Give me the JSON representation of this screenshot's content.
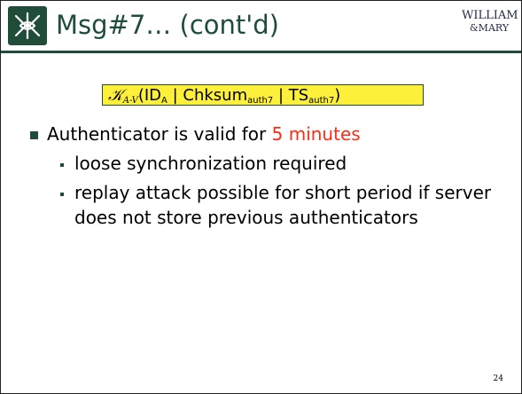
{
  "title": "Msg#7… (cont'd)",
  "brand": {
    "line1": "WILLIAM",
    "line2": "&MARY",
    "logo_icon": "cypher-seal-icon"
  },
  "formula": {
    "key_symbol": "𝒦",
    "key_sub": "A-V",
    "open": "(",
    "id": "ID",
    "id_sub": "A",
    "sep1": " | ",
    "chksum": "Chksum",
    "chksum_sub": "auth7",
    "sep2": " | ",
    "ts": "TS",
    "ts_sub": "auth7",
    "close": ")"
  },
  "bullet": {
    "prefix": "Authenticator is valid for ",
    "highlight": "5 minutes"
  },
  "sub_bullets": [
    "loose synchronization required",
    "replay attack possible for short period if server does not store previous authenticators"
  ],
  "page_number": "24",
  "colors": {
    "accent": "#1f4d3a",
    "highlight_bg": "#fdf03a",
    "emphasis": "#ff2a12"
  }
}
